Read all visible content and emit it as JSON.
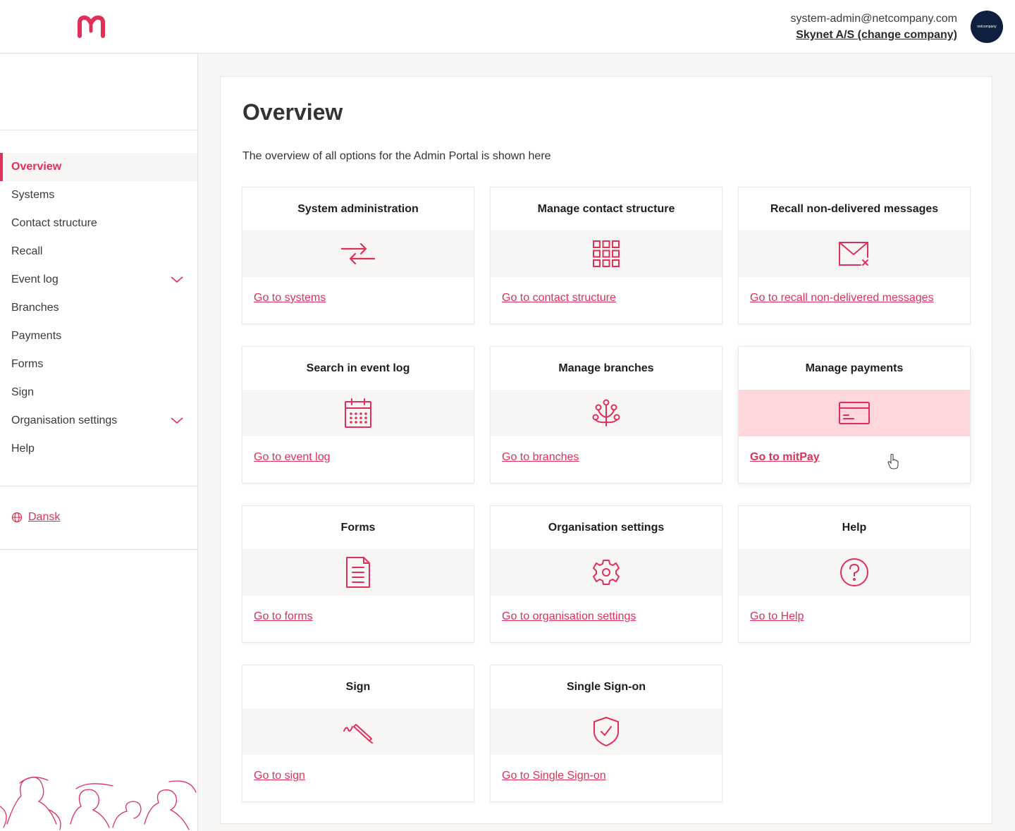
{
  "header": {
    "user_email": "system-admin@netcompany.com",
    "company": "Skynet A/S (change company)",
    "avatar_label": "netcompany"
  },
  "sidebar": {
    "items": [
      {
        "label": "Overview",
        "active": true
      },
      {
        "label": "Systems"
      },
      {
        "label": "Contact structure"
      },
      {
        "label": "Recall"
      },
      {
        "label": "Event log",
        "expandable": true
      },
      {
        "label": "Branches"
      },
      {
        "label": "Payments"
      },
      {
        "label": "Forms"
      },
      {
        "label": "Sign"
      },
      {
        "label": "Organisation settings",
        "expandable": true
      },
      {
        "label": "Help"
      }
    ],
    "language": "Dansk"
  },
  "main": {
    "title": "Overview",
    "description": "The overview of all options for the Admin Portal is shown here",
    "cards": [
      {
        "title": "System administration",
        "icon": "arrows-exchange-icon",
        "link": "Go to systems"
      },
      {
        "title": "Manage contact structure",
        "icon": "grid-icon",
        "link": "Go to contact structure"
      },
      {
        "title": "Recall non-delivered messages",
        "icon": "mail-cancel-icon",
        "link": "Go to recall non-delivered messages"
      },
      {
        "title": "Search in event log",
        "icon": "calendar-icon",
        "link": "Go to event log"
      },
      {
        "title": "Manage branches",
        "icon": "branches-icon",
        "link": "Go to branches"
      },
      {
        "title": "Manage payments",
        "icon": "credit-card-icon",
        "link": "Go to mitPay"
      },
      {
        "title": "Forms",
        "icon": "document-icon",
        "link": "Go to forms"
      },
      {
        "title": "Organisation settings",
        "icon": "gear-icon",
        "link": "Go to organisation settings"
      },
      {
        "title": "Help",
        "icon": "question-circle-icon",
        "link": "Go to Help"
      },
      {
        "title": "Sign",
        "icon": "pen-icon",
        "link": "Go to sign"
      },
      {
        "title": "Single Sign-on",
        "icon": "shield-check-icon",
        "link": "Go to Single Sign-on"
      }
    ]
  },
  "colors": {
    "accent": "#e0305a",
    "background": "#f8f6f4",
    "hover_band": "#fdd7dc",
    "avatar": "#0e1f40"
  }
}
